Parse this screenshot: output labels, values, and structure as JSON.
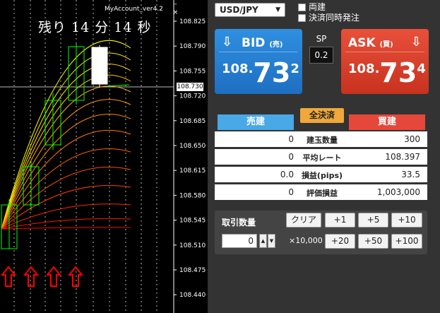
{
  "chart": {
    "account": "MyAccount_ver4.2",
    "remaining": "残り 14 分 14 秒",
    "y_labels": [
      "108.825",
      "108.790",
      "108.755",
      "108.720",
      "108.685",
      "108.650",
      "108.615",
      "108.580",
      "108.545",
      "108.510",
      "108.475",
      "108.440"
    ],
    "current_price": "108.730",
    "ctrl_minimize": "–",
    "ctrl_close": "×",
    "colors": {
      "background": "#000000",
      "up_arrow": "#ff0000",
      "candle": "#00ff00",
      "ma_high": "#ffff00",
      "ma_low": "#ff0000"
    }
  },
  "panel": {
    "pair": "USD/JPY",
    "options": [
      "両建",
      "決済同時発注"
    ],
    "bid": {
      "label": "BID",
      "suffix": "(売)",
      "prefix": "108.",
      "main": "73",
      "pip": "2",
      "arrow_icon": "arrow-down-icon"
    },
    "ask": {
      "label": "ASK",
      "suffix": "(買)",
      "prefix": "108.",
      "main": "73",
      "pip": "4",
      "arrow_icon": "arrow-down-icon"
    },
    "spread": {
      "label": "SP",
      "value": "0.2"
    },
    "tabs": {
      "sell": "売建",
      "close_all": "全決済",
      "buy": "買建"
    },
    "positions": [
      {
        "sell": "0",
        "label": "建玉数量",
        "buy": "300"
      },
      {
        "sell": "0",
        "label": "平均レート",
        "buy": "108.397"
      },
      {
        "sell": "0.0",
        "label": "損益(pips)",
        "buy": "33.5"
      },
      {
        "sell": "0",
        "label": "評価損益",
        "buy": "1,003,000"
      }
    ],
    "quantity": {
      "label": "取引数量",
      "value": "0",
      "unit": "×10,000",
      "clear": "クリア",
      "buttons": [
        "+1",
        "+5",
        "+10",
        "+20",
        "+50",
        "+100"
      ]
    }
  }
}
